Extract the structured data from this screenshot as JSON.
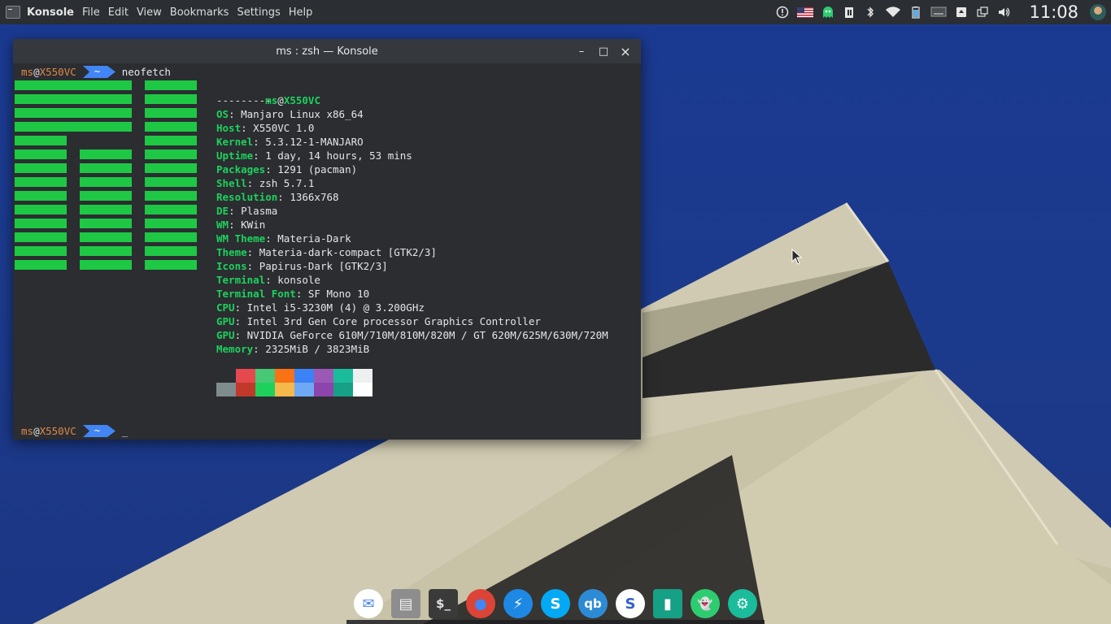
{
  "top_panel": {
    "app_name": "Konsole",
    "menu": [
      "File",
      "Edit",
      "View",
      "Bookmarks",
      "Settings",
      "Help"
    ],
    "clock": "11:08"
  },
  "window": {
    "title": "ms : zsh — Konsole",
    "controls": {
      "minimize": "–",
      "maximize": "□",
      "close": "×"
    }
  },
  "terminal": {
    "prompt_user": "ms",
    "prompt_at": "@",
    "prompt_host": "X550VC",
    "prompt_dir": "~",
    "command": "neofetch",
    "cursor": "_",
    "header_user": "ms",
    "header_at": "@",
    "header_host": "X550VC",
    "separator": "---------",
    "info": [
      {
        "key": "OS",
        "value": "Manjaro Linux x86_64"
      },
      {
        "key": "Host",
        "value": "X550VC 1.0"
      },
      {
        "key": "Kernel",
        "value": "5.3.12-1-MANJARO"
      },
      {
        "key": "Uptime",
        "value": "1 day, 14 hours, 53 mins"
      },
      {
        "key": "Packages",
        "value": "1291 (pacman)"
      },
      {
        "key": "Shell",
        "value": "zsh 5.7.1"
      },
      {
        "key": "Resolution",
        "value": "1366x768"
      },
      {
        "key": "DE",
        "value": "Plasma"
      },
      {
        "key": "WM",
        "value": "KWin"
      },
      {
        "key": "WM Theme",
        "value": "Materia-Dark"
      },
      {
        "key": "Theme",
        "value": "Materia-dark-compact [GTK2/3]"
      },
      {
        "key": "Icons",
        "value": "Papirus-Dark [GTK2/3]"
      },
      {
        "key": "Terminal",
        "value": "konsole"
      },
      {
        "key": "Terminal Font",
        "value": "SF Mono 10"
      },
      {
        "key": "CPU",
        "value": "Intel i5-3230M (4) @ 3.200GHz"
      },
      {
        "key": "GPU",
        "value": "Intel 3rd Gen Core processor Graphics Controller"
      },
      {
        "key": "GPU",
        "value": "NVIDIA GeForce 610M/710M/810M/820M / GT 620M/625M/630M/720M"
      },
      {
        "key": "Memory",
        "value": "2325MiB / 3823MiB"
      }
    ],
    "palette_top": [
      "#2b2d31",
      "#e5484d",
      "#48c774",
      "#f97316",
      "#3b82f6",
      "#9b59b6",
      "#1abc9c",
      "#ecf0f1"
    ],
    "palette_bottom": [
      "#7f8c8d",
      "#c0392b",
      "#1ed15d",
      "#f5b84a",
      "#6fa8f5",
      "#8e44ad",
      "#16a085",
      "#ffffff"
    ],
    "colors": {
      "key": "#1ed15d",
      "orange": "#e0894a",
      "logo": "#1ec845",
      "arrow": "#4285f4"
    }
  },
  "dock": {
    "apps": [
      {
        "name": "mail-icon",
        "glyph": "✉",
        "bg": "#ffffff",
        "fg": "#4a86e8"
      },
      {
        "name": "files-icon",
        "glyph": "▤",
        "bg": "#8d8d8d",
        "fg": "#f2f2f2"
      },
      {
        "name": "terminal-icon",
        "glyph": "$_",
        "bg": "#3a3a3a",
        "fg": "#e0e0e0"
      },
      {
        "name": "chrome-icon",
        "glyph": "●",
        "bg": "#db4437",
        "fg": "#4285f4"
      },
      {
        "name": "messenger-icon",
        "glyph": "⚡",
        "bg": "#1e88e5",
        "fg": "#ffffff"
      },
      {
        "name": "skype-icon",
        "glyph": "S",
        "bg": "#03a9f4",
        "fg": "#ffffff"
      },
      {
        "name": "qbittorrent-icon",
        "glyph": "qb",
        "bg": "#2d8bd6",
        "fg": "#ffffff"
      },
      {
        "name": "simplenote-icon",
        "glyph": "S",
        "bg": "#ffffff",
        "fg": "#3361cc"
      },
      {
        "name": "notes-icon",
        "glyph": "▮",
        "bg": "#16a085",
        "fg": "#ffffff"
      },
      {
        "name": "ghost-icon",
        "glyph": "👻",
        "bg": "#2ecc71",
        "fg": "#ffffff"
      },
      {
        "name": "settings-icon",
        "glyph": "⚙",
        "bg": "#1abc9c",
        "fg": "#ffffff"
      }
    ]
  }
}
